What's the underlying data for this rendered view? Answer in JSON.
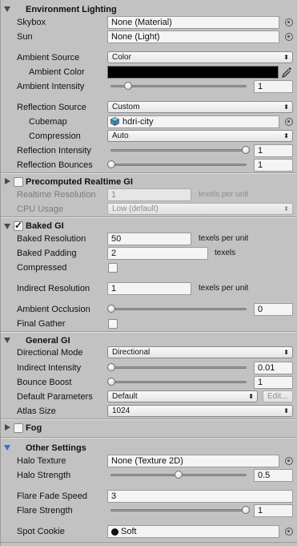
{
  "environment_lighting": {
    "title": "Environment Lighting",
    "skybox_label": "Skybox",
    "skybox_value": "None (Material)",
    "sun_label": "Sun",
    "sun_value": "None (Light)",
    "ambient_source_label": "Ambient Source",
    "ambient_source_value": "Color",
    "ambient_color_label": "Ambient Color",
    "ambient_color_value": "#000000",
    "ambient_intensity_label": "Ambient Intensity",
    "ambient_intensity_value": "1",
    "ambient_intensity_fraction": 0.125,
    "reflection_source_label": "Reflection Source",
    "reflection_source_value": "Custom",
    "cubemap_label": "Cubemap",
    "cubemap_value": "hdri-city",
    "compression_label": "Compression",
    "compression_value": "Auto",
    "reflection_intensity_label": "Reflection Intensity",
    "reflection_intensity_value": "1",
    "reflection_intensity_fraction": 1.0,
    "reflection_bounces_label": "Reflection Bounces",
    "reflection_bounces_value": "1",
    "reflection_bounces_fraction": 0.0
  },
  "precomputed_gi": {
    "title": "Precomputed Realtime GI",
    "enabled": false,
    "realtime_resolution_label": "Realtime Resolution",
    "realtime_resolution_value": "1",
    "realtime_resolution_unit": "texels per unit",
    "cpu_usage_label": "CPU Usage",
    "cpu_usage_value": "Low (default)"
  },
  "baked_gi": {
    "title": "Baked GI",
    "enabled": true,
    "baked_resolution_label": "Baked Resolution",
    "baked_resolution_value": "50",
    "baked_resolution_unit": "texels per unit",
    "baked_padding_label": "Baked Padding",
    "baked_padding_value": "2",
    "baked_padding_unit": "texels",
    "compressed_label": "Compressed",
    "indirect_resolution_label": "Indirect Resolution",
    "indirect_resolution_value": "1",
    "indirect_resolution_unit": "texels per unit",
    "ambient_occlusion_label": "Ambient Occlusion",
    "ambient_occlusion_value": "0",
    "ambient_occlusion_fraction": 0.0,
    "final_gather_label": "Final Gather"
  },
  "general_gi": {
    "title": "General GI",
    "directional_mode_label": "Directional Mode",
    "directional_mode_value": "Directional",
    "indirect_intensity_label": "Indirect Intensity",
    "indirect_intensity_value": "0.01",
    "indirect_intensity_fraction": 0.0,
    "bounce_boost_label": "Bounce Boost",
    "bounce_boost_value": "1",
    "bounce_boost_fraction": 0.0,
    "default_parameters_label": "Default Parameters",
    "default_parameters_value": "Default",
    "edit_button": "Edit...",
    "atlas_size_label": "Atlas Size",
    "atlas_size_value": "1024"
  },
  "fog": {
    "title": "Fog",
    "enabled": false
  },
  "other_settings": {
    "title": "Other Settings",
    "halo_texture_label": "Halo Texture",
    "halo_texture_value": "None (Texture 2D)",
    "halo_strength_label": "Halo Strength",
    "halo_strength_value": "0.5",
    "halo_strength_fraction": 0.5,
    "flare_fade_speed_label": "Flare Fade Speed",
    "flare_fade_speed_value": "3",
    "flare_strength_label": "Flare Strength",
    "flare_strength_value": "1",
    "flare_strength_fraction": 1.0,
    "spot_cookie_label": "Spot Cookie",
    "spot_cookie_value": "Soft"
  },
  "icons": {
    "foldout_expanded": "triangle-down-icon",
    "foldout_collapsed": "triangle-right-icon",
    "object_picker": "object-picker-icon",
    "eyedropper": "eyedropper-icon",
    "cubemap": "cubemap-icon",
    "dropdown_arrow": "updown-arrows-icon"
  },
  "colors": {
    "panel_background": "#c2c2c2",
    "other_settings_foldout": "#3a6fd8"
  }
}
